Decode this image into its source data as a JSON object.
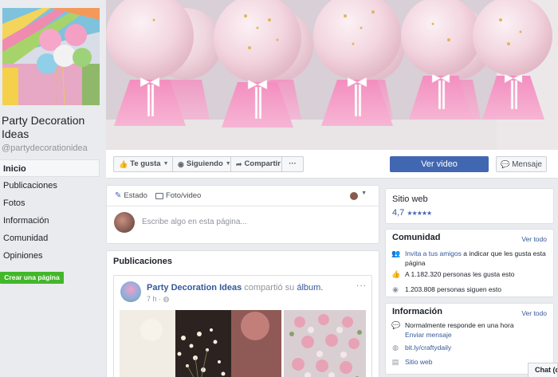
{
  "page": {
    "name": "Party Decoration Ideas",
    "handle": "@partydecorationidea"
  },
  "nav": {
    "items": [
      "Inicio",
      "Publicaciones",
      "Fotos",
      "Información",
      "Comunidad",
      "Opiniones"
    ],
    "active": "Inicio",
    "create_page": "Crear una página"
  },
  "actions": {
    "like": "Te gusta",
    "following": "Siguiendo",
    "share": "Compartir",
    "more": "···",
    "watch_video": "Ver video",
    "message": "Mensaje"
  },
  "composer": {
    "status_tab": "Estado",
    "photo_tab": "Foto/video",
    "placeholder": "Escribe algo en esta página..."
  },
  "feed": {
    "title": "Publicaciones",
    "post": {
      "author": "Party Decoration Ideas",
      "shared": "compartió su",
      "album": "álbum.",
      "time": "7 h ·",
      "more": "···"
    }
  },
  "sitio_web": {
    "title": "Sitio web",
    "rating": "4,7",
    "stars": "★★★★★"
  },
  "comunidad": {
    "title": "Comunidad",
    "ver_todo": "Ver todo",
    "invite_link": "Invita a tus amigos",
    "invite_text": " a indicar que les gusta esta página",
    "likes": "A 1.182.320 personas les gusta esto",
    "follows": "1.203.808 personas siguen esto"
  },
  "informacion": {
    "title": "Información",
    "ver_todo": "Ver todo",
    "response": "Normalmente responde en una hora",
    "send_message": "Enviar mensaje",
    "url": "bit.ly/craftydaily",
    "website": "Sitio web"
  },
  "chat": {
    "label": "Chat (de"
  },
  "colors": {
    "brand_blue": "#4267b2",
    "link_blue": "#365899",
    "create_green": "#42b72a",
    "background": "#e9ebee"
  }
}
